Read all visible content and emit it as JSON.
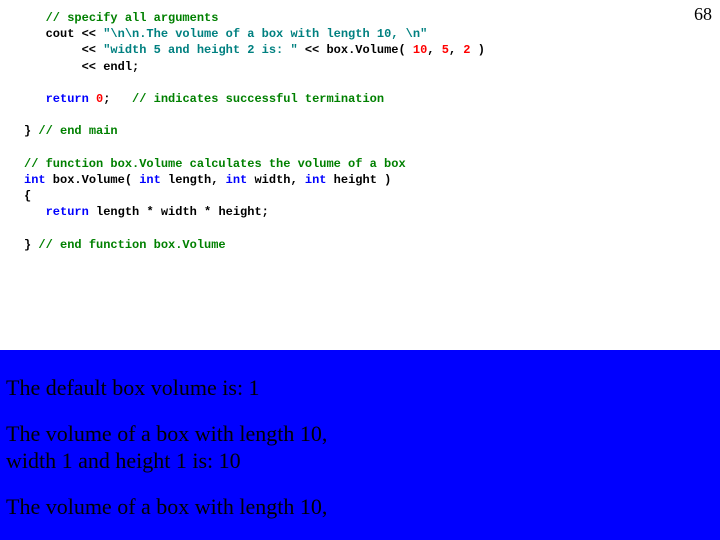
{
  "page_number": "68",
  "code": {
    "c1_a": "   ",
    "c1_b": "// specify all arguments",
    "c2_a": "   cout << ",
    "c2_b": "\"\\n\\n.The volume of a box with length 10, \\n\"",
    "c3_a": "        << ",
    "c3_b": "\"width 5 and height 2 is: \"",
    "c3_c": " << box.Volume( ",
    "c3_d": "10",
    "c3_e": ", ",
    "c3_f": "5",
    "c3_g": ", ",
    "c3_h": "2",
    "c3_i": " )",
    "c4_a": "        << endl;",
    "blank1": " ",
    "c5_a": "   ",
    "c5_b": "return",
    "c5_c": " ",
    "c5_d": "0",
    "c5_e": ";   ",
    "c5_f": "// indicates successful termination",
    "blank2": " ",
    "c6_a": "} ",
    "c6_b": "// end main",
    "blank3": " ",
    "c7_a": "// function box.Volume calculates the volume of a box",
    "c8_a": "int",
    "c8_b": " box.Volume( ",
    "c8_c": "int",
    "c8_d": " length, ",
    "c8_e": "int",
    "c8_f": " width, ",
    "c8_g": "int",
    "c8_h": " height )",
    "c9_a": "{",
    "c10_a": "   ",
    "c10_b": "return",
    "c10_c": " length * width * height;",
    "blank4": " ",
    "c11_a": "} ",
    "c11_b": "// end function box.Volume"
  },
  "output": {
    "line1": "The default box volume is: 1",
    "line2a": "The volume of a box with length 10,",
    "line2b": "width 1 and height 1 is: 10",
    "line3a": "The volume of a box with length 10,"
  }
}
